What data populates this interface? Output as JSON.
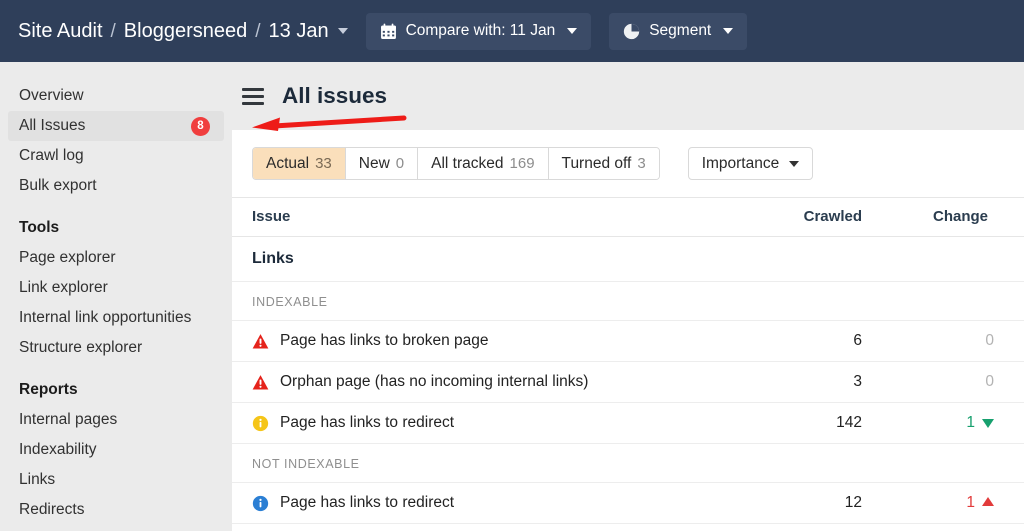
{
  "topbar": {
    "breadcrumbs": [
      "Site Audit",
      "Bloggersneed",
      "13 Jan"
    ],
    "separator": "/",
    "compare_label": "Compare with: 11 Jan",
    "compare_icon": "calendar-icon",
    "segment_label": "Segment",
    "segment_icon": "pie-chart-icon",
    "bg_color": "#2f3f5a"
  },
  "sidebar": {
    "items": [
      {
        "label": "Overview",
        "active": false,
        "badge": null
      },
      {
        "label": "All Issues",
        "active": true,
        "badge": "8"
      },
      {
        "label": "Crawl log",
        "active": false,
        "badge": null
      },
      {
        "label": "Bulk export",
        "active": false,
        "badge": null
      }
    ],
    "groups": [
      {
        "title": "Tools",
        "items": [
          {
            "label": "Page explorer"
          },
          {
            "label": "Link explorer"
          },
          {
            "label": "Internal link opportunities"
          },
          {
            "label": "Structure explorer"
          }
        ]
      },
      {
        "title": "Reports",
        "items": [
          {
            "label": "Internal pages"
          },
          {
            "label": "Indexability"
          },
          {
            "label": "Links"
          },
          {
            "label": "Redirects"
          }
        ]
      }
    ],
    "badge_color": "#f03e3e"
  },
  "main": {
    "menu_icon": "hamburger-icon",
    "title": "All issues",
    "filters": {
      "tabs": [
        {
          "label": "Actual",
          "count": "33",
          "selected": true
        },
        {
          "label": "New",
          "count": "0",
          "selected": false
        },
        {
          "label": "All tracked",
          "count": "169",
          "selected": false
        },
        {
          "label": "Turned off",
          "count": "3",
          "selected": false
        }
      ],
      "selected_color": "#fadfbb",
      "importance_label": "Importance"
    },
    "table": {
      "columns": [
        "Issue",
        "Crawled",
        "Change"
      ],
      "sections": [
        {
          "group": "Links",
          "subgroups": [
            {
              "label": "INDEXABLE",
              "rows": [
                {
                  "icon": "error-triangle-icon",
                  "severity": "error",
                  "issue": "Page has links to broken page",
                  "crawled": "6",
                  "change": "0",
                  "direction": "none"
                },
                {
                  "icon": "error-triangle-icon",
                  "severity": "error",
                  "issue": "Orphan page (has no incoming internal links)",
                  "crawled": "3",
                  "change": "0",
                  "direction": "none"
                },
                {
                  "icon": "warning-circle-icon",
                  "severity": "warning",
                  "issue": "Page has links to redirect",
                  "crawled": "142",
                  "change": "1",
                  "direction": "down"
                }
              ]
            },
            {
              "label": "NOT INDEXABLE",
              "rows": [
                {
                  "icon": "info-circle-icon",
                  "severity": "info",
                  "issue": "Page has links to redirect",
                  "crawled": "12",
                  "change": "1",
                  "direction": "up"
                }
              ]
            }
          ]
        }
      ],
      "colors": {
        "error": "#e5231b",
        "warning": "#f5c518",
        "info": "#2b7fd4",
        "change_down": "#17a06e",
        "change_up": "#e23b3b",
        "change_zero": "#b3b3b3"
      }
    }
  },
  "annotation": {
    "arrow_color": "#ee1c18",
    "direction": "left"
  }
}
